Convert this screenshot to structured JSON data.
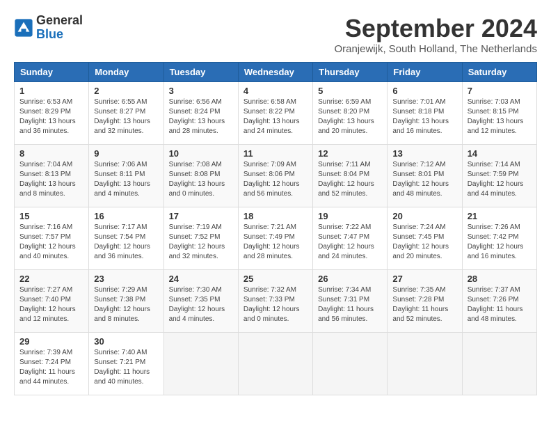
{
  "header": {
    "logo_line1": "General",
    "logo_line2": "Blue",
    "title": "September 2024",
    "subtitle": "Oranjewijk, South Holland, The Netherlands"
  },
  "days_of_week": [
    "Sunday",
    "Monday",
    "Tuesday",
    "Wednesday",
    "Thursday",
    "Friday",
    "Saturday"
  ],
  "weeks": [
    [
      {
        "day": "1",
        "sunrise": "6:53 AM",
        "sunset": "8:29 PM",
        "daylight": "13 hours and 36 minutes."
      },
      {
        "day": "2",
        "sunrise": "6:55 AM",
        "sunset": "8:27 PM",
        "daylight": "13 hours and 32 minutes."
      },
      {
        "day": "3",
        "sunrise": "6:56 AM",
        "sunset": "8:24 PM",
        "daylight": "13 hours and 28 minutes."
      },
      {
        "day": "4",
        "sunrise": "6:58 AM",
        "sunset": "8:22 PM",
        "daylight": "13 hours and 24 minutes."
      },
      {
        "day": "5",
        "sunrise": "6:59 AM",
        "sunset": "8:20 PM",
        "daylight": "13 hours and 20 minutes."
      },
      {
        "day": "6",
        "sunrise": "7:01 AM",
        "sunset": "8:18 PM",
        "daylight": "13 hours and 16 minutes."
      },
      {
        "day": "7",
        "sunrise": "7:03 AM",
        "sunset": "8:15 PM",
        "daylight": "13 hours and 12 minutes."
      }
    ],
    [
      {
        "day": "8",
        "sunrise": "7:04 AM",
        "sunset": "8:13 PM",
        "daylight": "13 hours and 8 minutes."
      },
      {
        "day": "9",
        "sunrise": "7:06 AM",
        "sunset": "8:11 PM",
        "daylight": "13 hours and 4 minutes."
      },
      {
        "day": "10",
        "sunrise": "7:08 AM",
        "sunset": "8:08 PM",
        "daylight": "13 hours and 0 minutes."
      },
      {
        "day": "11",
        "sunrise": "7:09 AM",
        "sunset": "8:06 PM",
        "daylight": "12 hours and 56 minutes."
      },
      {
        "day": "12",
        "sunrise": "7:11 AM",
        "sunset": "8:04 PM",
        "daylight": "12 hours and 52 minutes."
      },
      {
        "day": "13",
        "sunrise": "7:12 AM",
        "sunset": "8:01 PM",
        "daylight": "12 hours and 48 minutes."
      },
      {
        "day": "14",
        "sunrise": "7:14 AM",
        "sunset": "7:59 PM",
        "daylight": "12 hours and 44 minutes."
      }
    ],
    [
      {
        "day": "15",
        "sunrise": "7:16 AM",
        "sunset": "7:57 PM",
        "daylight": "12 hours and 40 minutes."
      },
      {
        "day": "16",
        "sunrise": "7:17 AM",
        "sunset": "7:54 PM",
        "daylight": "12 hours and 36 minutes."
      },
      {
        "day": "17",
        "sunrise": "7:19 AM",
        "sunset": "7:52 PM",
        "daylight": "12 hours and 32 minutes."
      },
      {
        "day": "18",
        "sunrise": "7:21 AM",
        "sunset": "7:49 PM",
        "daylight": "12 hours and 28 minutes."
      },
      {
        "day": "19",
        "sunrise": "7:22 AM",
        "sunset": "7:47 PM",
        "daylight": "12 hours and 24 minutes."
      },
      {
        "day": "20",
        "sunrise": "7:24 AM",
        "sunset": "7:45 PM",
        "daylight": "12 hours and 20 minutes."
      },
      {
        "day": "21",
        "sunrise": "7:26 AM",
        "sunset": "7:42 PM",
        "daylight": "12 hours and 16 minutes."
      }
    ],
    [
      {
        "day": "22",
        "sunrise": "7:27 AM",
        "sunset": "7:40 PM",
        "daylight": "12 hours and 12 minutes."
      },
      {
        "day": "23",
        "sunrise": "7:29 AM",
        "sunset": "7:38 PM",
        "daylight": "12 hours and 8 minutes."
      },
      {
        "day": "24",
        "sunrise": "7:30 AM",
        "sunset": "7:35 PM",
        "daylight": "12 hours and 4 minutes."
      },
      {
        "day": "25",
        "sunrise": "7:32 AM",
        "sunset": "7:33 PM",
        "daylight": "12 hours and 0 minutes."
      },
      {
        "day": "26",
        "sunrise": "7:34 AM",
        "sunset": "7:31 PM",
        "daylight": "11 hours and 56 minutes."
      },
      {
        "day": "27",
        "sunrise": "7:35 AM",
        "sunset": "7:28 PM",
        "daylight": "11 hours and 52 minutes."
      },
      {
        "day": "28",
        "sunrise": "7:37 AM",
        "sunset": "7:26 PM",
        "daylight": "11 hours and 48 minutes."
      }
    ],
    [
      {
        "day": "29",
        "sunrise": "7:39 AM",
        "sunset": "7:24 PM",
        "daylight": "11 hours and 44 minutes."
      },
      {
        "day": "30",
        "sunrise": "7:40 AM",
        "sunset": "7:21 PM",
        "daylight": "11 hours and 40 minutes."
      },
      null,
      null,
      null,
      null,
      null
    ]
  ],
  "labels": {
    "sunrise": "Sunrise:",
    "sunset": "Sunset:",
    "daylight": "Daylight:"
  }
}
